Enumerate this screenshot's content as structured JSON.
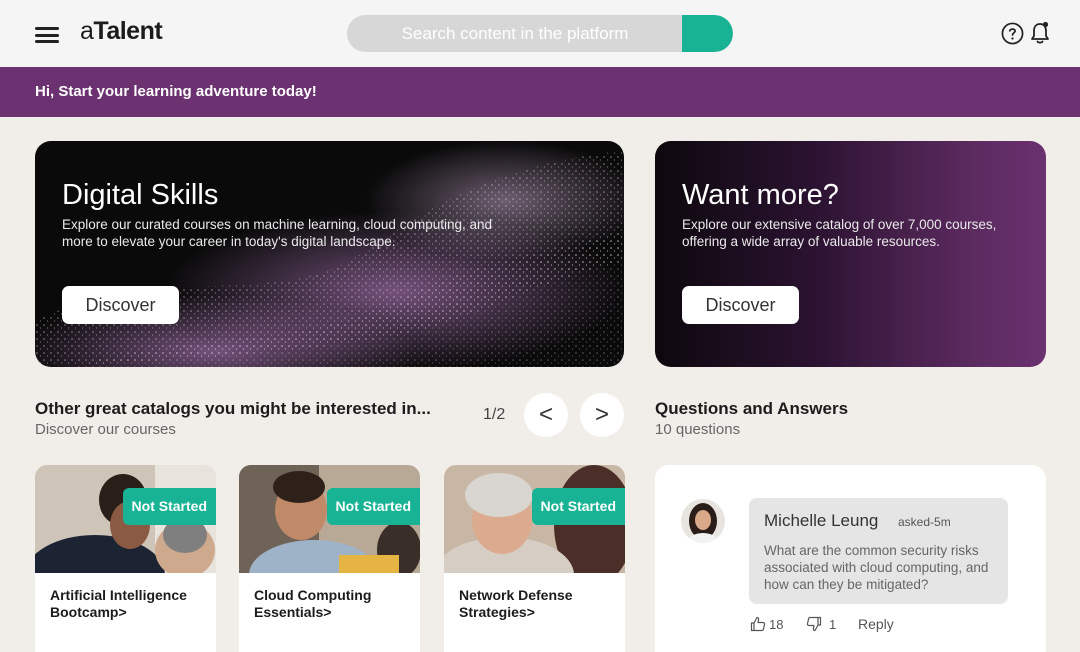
{
  "header": {
    "logo_prefix": "a",
    "logo_main": "Talent",
    "search_placeholder": "Search content in the platform",
    "accent_color": "#17b394"
  },
  "welcome": {
    "text": "Hi, Start your learning adventure today!",
    "bg_color": "#6b3170"
  },
  "heroes": [
    {
      "title": "Digital Skills",
      "description": "Explore our curated courses on machine learning, cloud computing, and more to elevate your career in today's digital landscape.",
      "button": "Discover"
    },
    {
      "title": "Want more?",
      "description": "Explore our extensive catalog of over 7,000 courses, offering a wide array of valuable resources.",
      "button": "Discover"
    }
  ],
  "catalogs": {
    "title": "Other great catalogs you might be interested in...",
    "subtitle": "Discover our courses",
    "pager": "1/2",
    "prev_icon": "chevron-left-icon",
    "next_icon": "chevron-right-icon",
    "prev_label": "<",
    "next_label": ">",
    "courses": [
      {
        "status": "Not Started",
        "title": "Artificial Intelligence Bootcamp>"
      },
      {
        "status": "Not Started",
        "title": "Cloud Computing Essentials>"
      },
      {
        "status": "Not Started",
        "title": "Network Defense Strategies>"
      }
    ]
  },
  "qa": {
    "title": "Questions and Answers",
    "subtitle": "10 questions",
    "question": {
      "author": "Michelle Leung",
      "meta": "asked-5m",
      "text": "What are the common security risks associated with cloud computing, and how can they be mitigated?",
      "likes": "18",
      "dislikes": "1",
      "reply": "Reply"
    }
  }
}
